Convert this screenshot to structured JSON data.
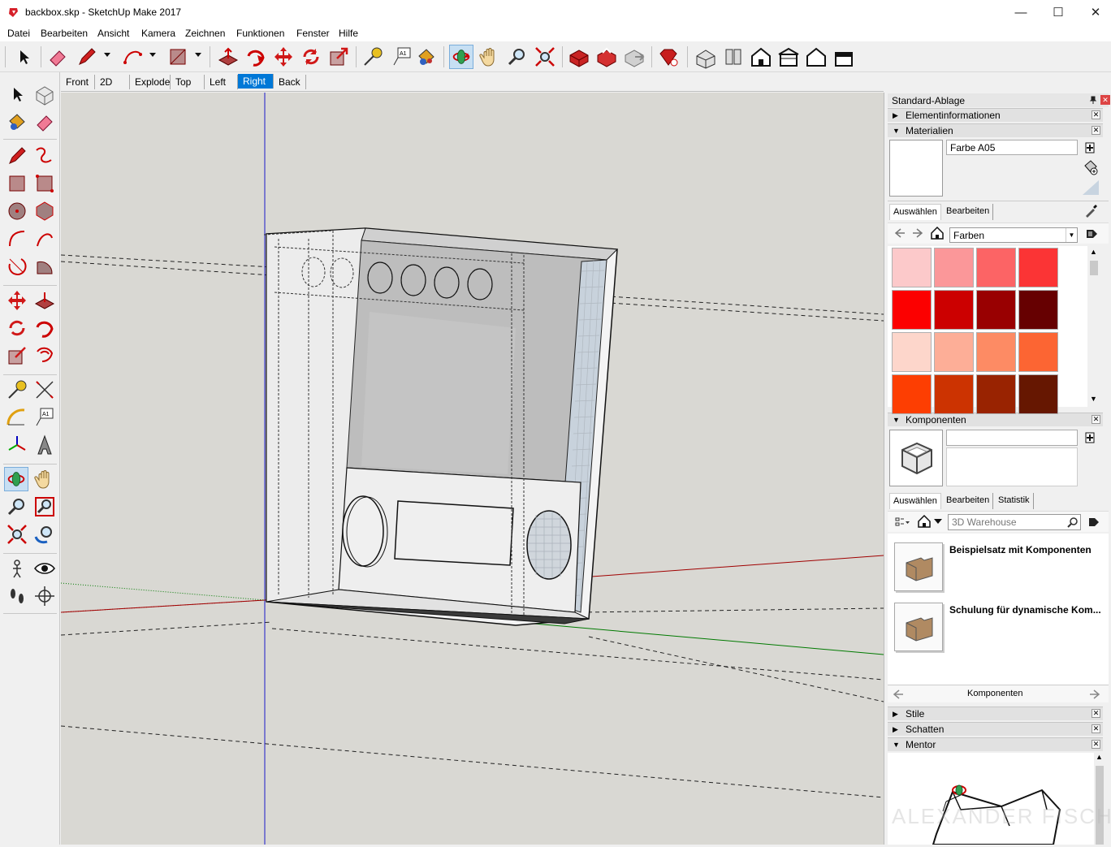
{
  "window": {
    "title": "backbox.skp - SketchUp Make 2017",
    "minimize": "—",
    "maximize": "☐",
    "close": "✕"
  },
  "menu": [
    "Datei",
    "Bearbeiten",
    "Ansicht",
    "Kamera",
    "Zeichnen",
    "Funktionen",
    "Fenster",
    "Hilfe"
  ],
  "scenes": {
    "tabs": [
      "Front",
      "2D",
      "Explode",
      "Top",
      "Left",
      "Right",
      "Back"
    ],
    "active": "Right"
  },
  "tray": {
    "title": "Standard-Ablage",
    "entity_info": {
      "title": "Elementinformationen"
    },
    "materials": {
      "title": "Materialien",
      "material_name": "Farbe A05",
      "tabs": [
        "Auswählen",
        "Bearbeiten"
      ],
      "library": "Farben",
      "swatches": [
        "#fcc9ca",
        "#fb9799",
        "#fc6465",
        "#fb3435",
        "#fc0000",
        "#cc0000",
        "#990001",
        "#660001",
        "#fdd6cb",
        "#fdae97",
        "#fd8b64",
        "#fc6533",
        "#fd3e02",
        "#cc3301",
        "#992301",
        "#661701"
      ]
    },
    "components": {
      "title": "Komponenten",
      "tabs": [
        "Auswählen",
        "Bearbeiten",
        "Statistik"
      ],
      "search_placeholder": "3D Warehouse",
      "items": [
        {
          "title": "Beispielsatz mit Komponenten"
        },
        {
          "title": "Schulung für dynamische Kom..."
        }
      ],
      "footer": "Komponenten"
    },
    "styles": {
      "title": "Stile"
    },
    "shadows": {
      "title": "Schatten"
    },
    "mentor": {
      "title": "Mentor"
    }
  },
  "colors": {
    "accent": "#0078d7",
    "x_axis": "#a00000",
    "y_axis": "#007a00",
    "z_axis": "#0000c0"
  },
  "watermark": "ALEXANDER FISCHER"
}
